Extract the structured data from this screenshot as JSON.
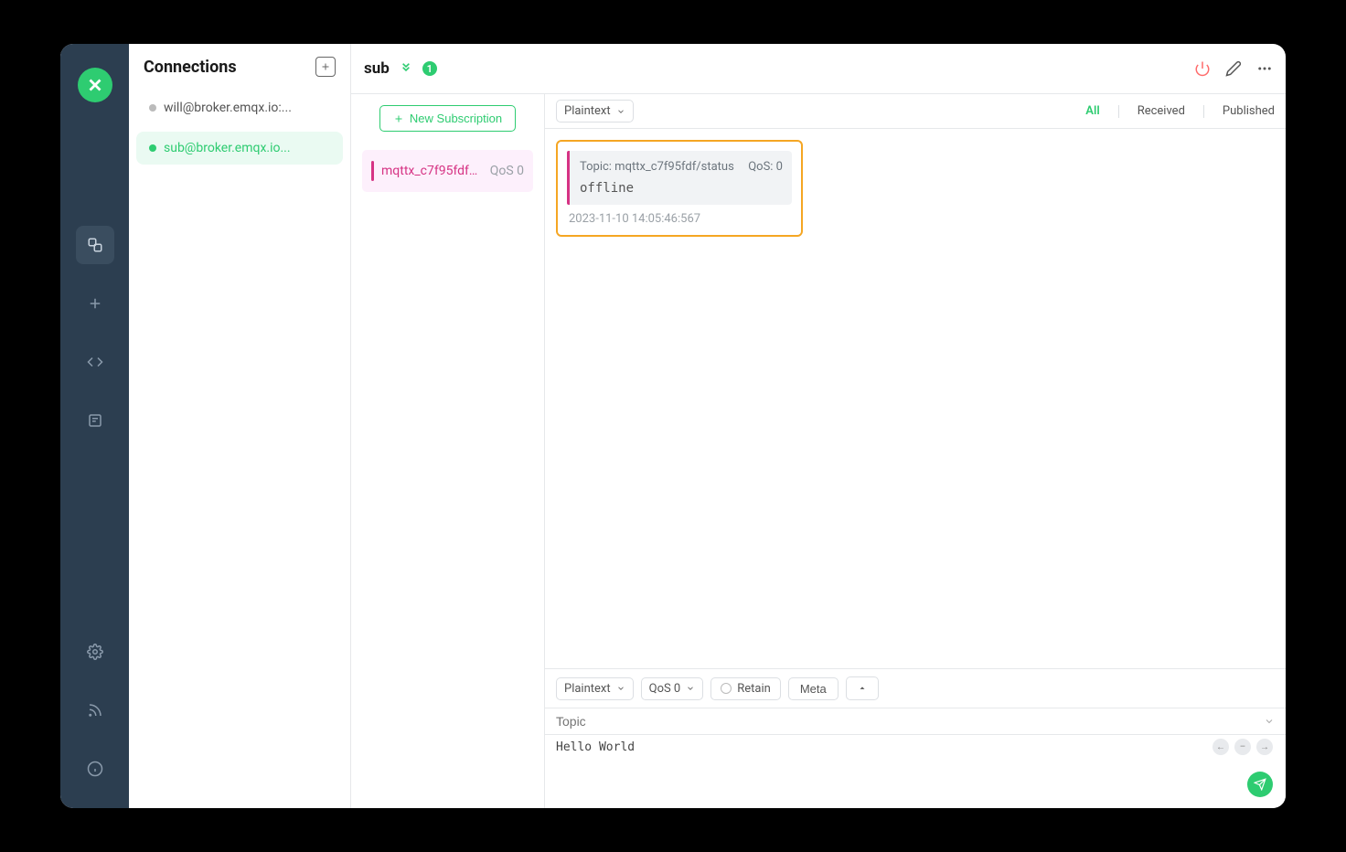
{
  "sidebar": {
    "title": "Connections",
    "connections": [
      {
        "label": "will@broker.emqx.io:...",
        "active": false
      },
      {
        "label": "sub@broker.emqx.io...",
        "active": true
      }
    ]
  },
  "header": {
    "connection_name": "sub",
    "badge_count": "1",
    "filter_tabs": {
      "all": "All",
      "received": "Received",
      "published": "Published"
    }
  },
  "subscriptions": {
    "new_button": "New Subscription",
    "items": [
      {
        "topic": "mqttx_c7f95fdf/...",
        "qos": "QoS 0"
      }
    ]
  },
  "msg_toolbar": {
    "format": "Plaintext"
  },
  "messages": [
    {
      "topic_label": "Topic: mqttx_c7f95fdf/status",
      "qos_label": "QoS: 0",
      "payload": "offline",
      "timestamp": "2023-11-10 14:05:46:567"
    }
  ],
  "publish": {
    "format": "Plaintext",
    "qos": "QoS 0",
    "retain": "Retain",
    "meta": "Meta",
    "topic_placeholder": "Topic",
    "payload_value": "Hello World"
  }
}
